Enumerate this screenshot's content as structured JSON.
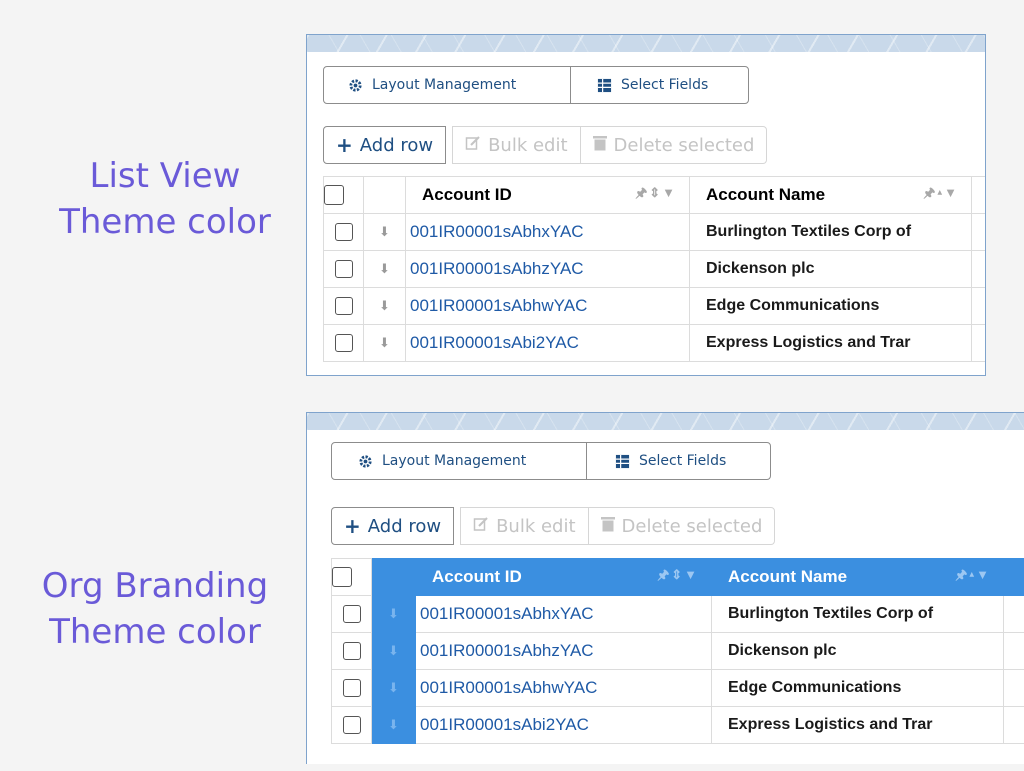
{
  "labels": {
    "list_view": [
      "List View",
      "Theme color"
    ],
    "org_branding": [
      "Org Branding",
      "Theme color"
    ]
  },
  "toolbar": {
    "layout_management": "Layout Management",
    "select_fields": "Select Fields"
  },
  "actions": {
    "add_row": "Add row",
    "bulk_edit": "Bulk edit",
    "delete_selected": "Delete selected"
  },
  "columns": {
    "account_id": "Account ID",
    "account_name": "Account Name"
  },
  "rows": [
    {
      "id": "001IR00001sAbhxYAC",
      "name": "Burlington Textiles Corp of"
    },
    {
      "id": "001IR00001sAbhzYAC",
      "name": "Dickenson plc"
    },
    {
      "id": "001IR00001sAbhwYAC",
      "name": "Edge Communications"
    },
    {
      "id": "001IR00001sAbi2YAC",
      "name": "Express Logistics and Trar"
    }
  ],
  "colors": {
    "label_text": "#6a5ad8",
    "org_branding_theme": "#3b8fe0",
    "link": "#1f5aa6"
  },
  "icons": {
    "layout_management": "gear-icon",
    "select_fields": "fields-grid-icon",
    "add_row": "plus-icon",
    "bulk_edit": "edit-icon",
    "delete_selected": "trash-icon",
    "pin": "pin-icon",
    "column_menu": [
      "pin-icon",
      "sort-icon",
      "filter-icon"
    ]
  }
}
